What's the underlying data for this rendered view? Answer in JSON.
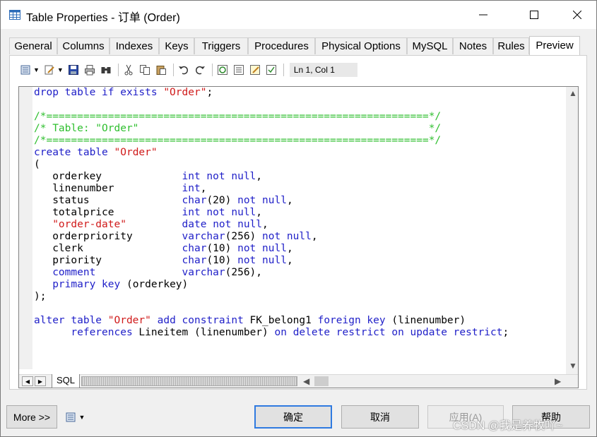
{
  "window": {
    "title": "Table Properties - 订单 (Order)",
    "controls": {
      "minimize": "—",
      "maximize": "☐",
      "close": "✕"
    }
  },
  "tabs": [
    {
      "label": "General"
    },
    {
      "label": "Columns"
    },
    {
      "label": "Indexes"
    },
    {
      "label": "Keys"
    },
    {
      "label": "Triggers"
    },
    {
      "label": "Procedures"
    },
    {
      "label": "Physical Options"
    },
    {
      "label": "MySQL"
    },
    {
      "label": "Notes"
    },
    {
      "label": "Rules"
    },
    {
      "label": "Preview",
      "active": true
    }
  ],
  "toolbar": {
    "position": "Ln 1, Col 1",
    "icons": [
      "script-options-icon",
      "edit-icon",
      "save-icon",
      "print-icon",
      "find-icon",
      "cut-icon",
      "copy-icon",
      "paste-icon",
      "undo-icon",
      "redo-icon",
      "refresh-icon",
      "list-icon",
      "edit-document-icon",
      "checklist-icon"
    ]
  },
  "editor": {
    "lines": [
      [
        {
          "t": "drop table if exists ",
          "c": "kw"
        },
        {
          "t": "\"Order\"",
          "c": "str"
        },
        {
          "t": ";",
          "c": ""
        }
      ],
      [],
      [
        {
          "t": "/*==============================================================*/",
          "c": "cmt"
        }
      ],
      [
        {
          "t": "/* Table: \"Order\"                                               */",
          "c": "cmt"
        }
      ],
      [
        {
          "t": "/*==============================================================*/",
          "c": "cmt"
        }
      ],
      [
        {
          "t": "create table ",
          "c": "kw"
        },
        {
          "t": "\"Order\"",
          "c": "str"
        }
      ],
      [
        {
          "t": "(",
          "c": ""
        }
      ],
      [
        {
          "t": "   orderkey             ",
          "c": ""
        },
        {
          "t": "int not null",
          "c": "kw"
        },
        {
          "t": ",",
          "c": ""
        }
      ],
      [
        {
          "t": "   linenumber           ",
          "c": ""
        },
        {
          "t": "int",
          "c": "kw"
        },
        {
          "t": ",",
          "c": ""
        }
      ],
      [
        {
          "t": "   status               ",
          "c": ""
        },
        {
          "t": "char",
          "c": "kw"
        },
        {
          "t": "(20) ",
          "c": ""
        },
        {
          "t": "not null",
          "c": "kw"
        },
        {
          "t": ",",
          "c": ""
        }
      ],
      [
        {
          "t": "   totalprice           ",
          "c": ""
        },
        {
          "t": "int not null",
          "c": "kw"
        },
        {
          "t": ",",
          "c": ""
        }
      ],
      [
        {
          "t": "   ",
          "c": ""
        },
        {
          "t": "\"order-date\"",
          "c": "str"
        },
        {
          "t": "         ",
          "c": ""
        },
        {
          "t": "date not null",
          "c": "kw"
        },
        {
          "t": ",",
          "c": ""
        }
      ],
      [
        {
          "t": "   orderpriority        ",
          "c": ""
        },
        {
          "t": "varchar",
          "c": "kw"
        },
        {
          "t": "(256) ",
          "c": ""
        },
        {
          "t": "not null",
          "c": "kw"
        },
        {
          "t": ",",
          "c": ""
        }
      ],
      [
        {
          "t": "   clerk                ",
          "c": ""
        },
        {
          "t": "char",
          "c": "kw"
        },
        {
          "t": "(10) ",
          "c": ""
        },
        {
          "t": "not null",
          "c": "kw"
        },
        {
          "t": ",",
          "c": ""
        }
      ],
      [
        {
          "t": "   priority             ",
          "c": ""
        },
        {
          "t": "char",
          "c": "kw"
        },
        {
          "t": "(10) ",
          "c": ""
        },
        {
          "t": "not null",
          "c": "kw"
        },
        {
          "t": ",",
          "c": ""
        }
      ],
      [
        {
          "t": "   ",
          "c": ""
        },
        {
          "t": "comment",
          "c": "kw"
        },
        {
          "t": "              ",
          "c": ""
        },
        {
          "t": "varchar",
          "c": "kw"
        },
        {
          "t": "(256),",
          "c": ""
        }
      ],
      [
        {
          "t": "   ",
          "c": ""
        },
        {
          "t": "primary key",
          "c": "kw"
        },
        {
          "t": " (orderkey)",
          "c": ""
        }
      ],
      [
        {
          "t": ");",
          "c": ""
        }
      ],
      [],
      [
        {
          "t": "alter table ",
          "c": "kw"
        },
        {
          "t": "\"Order\"",
          "c": "str"
        },
        {
          "t": " ",
          "c": ""
        },
        {
          "t": "add constraint",
          "c": "kw"
        },
        {
          "t": " FK_belong1 ",
          "c": ""
        },
        {
          "t": "foreign key",
          "c": "kw"
        },
        {
          "t": " (linenumber)",
          "c": ""
        }
      ],
      [
        {
          "t": "      ",
          "c": ""
        },
        {
          "t": "references",
          "c": "kw"
        },
        {
          "t": " Lineitem (linenumber) ",
          "c": ""
        },
        {
          "t": "on delete restrict on update restrict",
          "c": "kw"
        },
        {
          "t": ";",
          "c": ""
        }
      ]
    ],
    "sheet_tab": "SQL",
    "colors": {
      "keyword": "#1f1fc8",
      "string": "#d01a1a",
      "comment": "#2fbf2f"
    }
  },
  "buttons": {
    "more": "More >>",
    "ok": "确定",
    "cancel": "取消",
    "apply": "应用(A)",
    "help": "帮助"
  },
  "watermark": "CSDN @我是养牧吖~"
}
